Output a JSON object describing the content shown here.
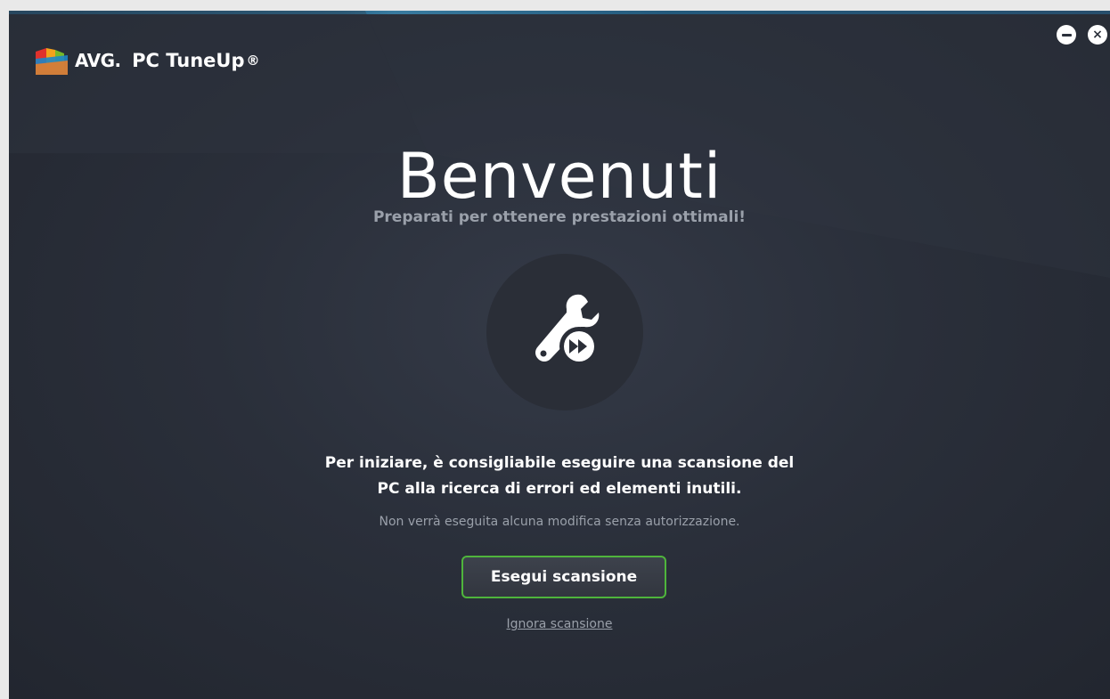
{
  "app": {
    "brand": "AVG",
    "brand_dot": ".",
    "product": "PC TuneUp",
    "registered": "®"
  },
  "window_controls": {
    "minimize_icon": "minimize-icon",
    "close_icon": "close-icon",
    "close_glyph": "×"
  },
  "welcome": {
    "title": "Benvenuti",
    "subtitle": "Preparati per ottenere prestazioni ottimali!",
    "hero_icon": "wrench-fast-forward-icon",
    "message_line1": "Per iniziare, è consigliabile eseguire una scansione del",
    "message_line2": "PC alla ricerca di errori ed elementi inutili.",
    "note": "Non verrà eseguita alcuna modifica senza autorizzazione.",
    "scan_button": "Esegui scansione",
    "skip_link": "Ignora scansione"
  },
  "colors": {
    "background": "#2a2f3a",
    "accent_green": "#4fb53c",
    "accent_blue": "#3da0d2",
    "muted_text": "#9aa0aa"
  }
}
